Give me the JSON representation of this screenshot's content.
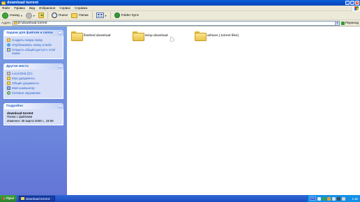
{
  "window": {
    "title": "download torrent",
    "controls": {
      "minimize": "_",
      "maximize": "□",
      "close": "×"
    }
  },
  "menu": [
    "Файл",
    "Правка",
    "Вид",
    "Избранное",
    "Сервис",
    "Справка"
  ],
  "toolbar": {
    "back_label": "Назад",
    "search_label": "Поиск",
    "folders_label": "Папки",
    "folder_sync_label": "Folder Sync"
  },
  "address": {
    "label": "Адрес",
    "value": "D:\\download torrent",
    "go_label": "Переход"
  },
  "left_panel": {
    "tasks": {
      "title": "Задачи для файлов и папок",
      "items": [
        {
          "label": "Создать новую папку",
          "icon": "new-folder-icon"
        },
        {
          "label": "Опубликовать папку в вебе",
          "icon": "web-publish-icon"
        },
        {
          "label": "Открыть общий доступ к этой папке",
          "icon": "share-folder-icon"
        }
      ]
    },
    "places": {
      "title": "Другие места",
      "items": [
        {
          "label": "Local Disk (D:)",
          "icon": "disk-icon"
        },
        {
          "label": "Мои документы",
          "icon": "my-documents-icon"
        },
        {
          "label": "Общие документы",
          "icon": "shared-documents-icon"
        },
        {
          "label": "Мой компьютер",
          "icon": "my-computer-icon"
        },
        {
          "label": "Сетевое окружение",
          "icon": "network-icon"
        }
      ]
    },
    "details": {
      "title": "Подробно",
      "name": "download torrent",
      "type": "Папка с файлами",
      "modified": "Изменен: 30 марта 2008 г., 19:59"
    }
  },
  "files": [
    {
      "name": "finished download"
    },
    {
      "name": "temp download"
    },
    {
      "name": "arhives (.torrent files)"
    }
  ],
  "taskbar": {
    "start_label": "Пуск",
    "window_label": "download torrent",
    "lang": "EN",
    "clock": "1:45"
  }
}
